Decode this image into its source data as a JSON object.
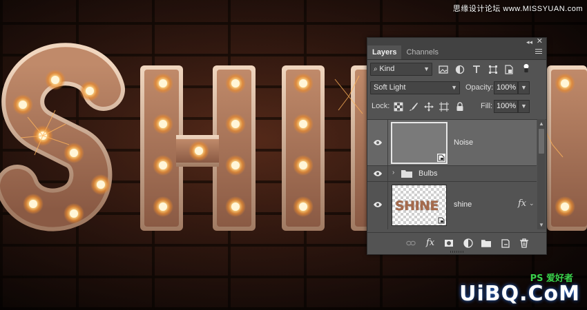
{
  "artwork": {
    "text": "SHINE",
    "watermark_top": "思缘设计论坛 www.MISSYUAN.com",
    "logo_bottom": "UiBQ.CoM",
    "logo_bottom_sub": "PS 爱好者",
    "colors": {
      "bulb": "#ffd27a",
      "letter_face": "#a7735a",
      "letter_rim": "#d9b59a",
      "brick": "#3a1c14"
    }
  },
  "panel": {
    "tabs": [
      {
        "label": "Layers",
        "active": true
      },
      {
        "label": "Channels",
        "active": false
      }
    ],
    "filter": {
      "kind_label": "Kind",
      "icons": [
        "image-filter-icon",
        "adjustment-filter-icon",
        "type-filter-icon",
        "shape-filter-icon",
        "smart-object-filter-icon",
        "filter-toggle-icon"
      ]
    },
    "blend_mode": "Soft Light",
    "opacity_label": "Opacity:",
    "opacity_value": "100%",
    "lock_label": "Lock:",
    "fill_label": "Fill:",
    "fill_value": "100%",
    "layers": [
      {
        "name": "Noise",
        "selected": true,
        "type": "smart-object"
      },
      {
        "name": "Bulbs",
        "selected": false,
        "type": "group"
      },
      {
        "name": "shine",
        "selected": false,
        "type": "smart-object",
        "thumb_text": "SHINE",
        "fx": "fx"
      }
    ],
    "footer_icons": [
      "link-layers-icon",
      "fx-icon",
      "mask-icon",
      "adjustment-layer-icon",
      "new-group-icon",
      "new-layer-icon",
      "trash-icon"
    ],
    "footer_fx": "fx",
    "colors": {
      "panel_bg": "#535353",
      "selected_row": "#676767",
      "tab_bar": "#424242"
    }
  }
}
